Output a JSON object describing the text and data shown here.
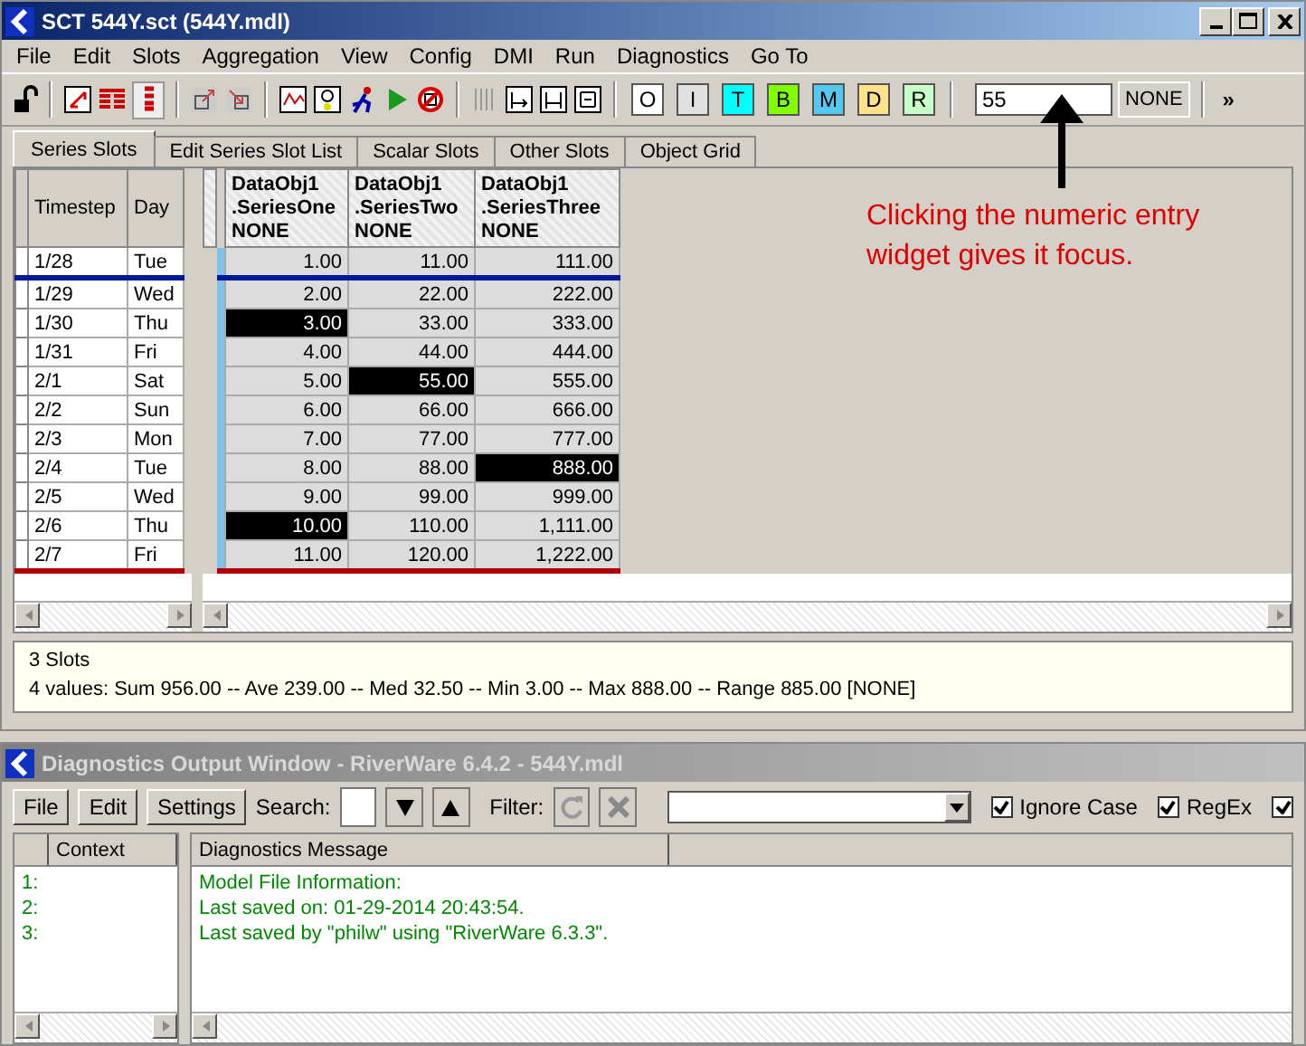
{
  "window": {
    "title": "SCT 544Y.sct (544Y.mdl)",
    "active": true
  },
  "menu": [
    "File",
    "Edit",
    "Slots",
    "Aggregation",
    "View",
    "Config",
    "DMI",
    "Run",
    "Diagnostics",
    "Go To"
  ],
  "flags": [
    {
      "label": "O",
      "color": "#ffffff"
    },
    {
      "label": "I",
      "color": "#e0e0e0"
    },
    {
      "label": "T",
      "color": "#00ffff"
    },
    {
      "label": "B",
      "color": "#80ff00"
    },
    {
      "label": "M",
      "color": "#55c8f0"
    },
    {
      "label": "D",
      "color": "#ffe28a"
    },
    {
      "label": "R",
      "color": "#c8ffc8"
    }
  ],
  "numeric_entry": {
    "value": "55",
    "units": "NONE"
  },
  "overflow": "»",
  "tabs": [
    {
      "label": "Series Slots",
      "selected": true
    },
    {
      "label": "Edit Series Slot List",
      "selected": false
    },
    {
      "label": "Scalar Slots",
      "selected": false
    },
    {
      "label": "Other Slots",
      "selected": false
    },
    {
      "label": "Object Grid",
      "selected": false
    }
  ],
  "annotation": "Clicking the numeric entry widget gives it focus.",
  "grid": {
    "columns": [
      "Timestep",
      "Day"
    ],
    "series": [
      {
        "object": "DataObj1",
        "slot": ".SeriesOne",
        "units": "NONE"
      },
      {
        "object": "DataObj1",
        "slot": ".SeriesTwo",
        "units": "NONE"
      },
      {
        "object": "DataObj1",
        "slot": ".SeriesThree",
        "units": "NONE"
      }
    ],
    "rows": [
      {
        "timestep": "1/28",
        "day": "Tue",
        "cells": [
          {
            "value": "1.00",
            "selected": false
          },
          {
            "value": "11.00",
            "selected": false
          },
          {
            "value": "111.00",
            "selected": false
          }
        ]
      },
      {
        "timestep": "1/29",
        "day": "Wed",
        "cells": [
          {
            "value": "2.00",
            "selected": false
          },
          {
            "value": "22.00",
            "selected": false
          },
          {
            "value": "222.00",
            "selected": false
          }
        ]
      },
      {
        "timestep": "1/30",
        "day": "Thu",
        "cells": [
          {
            "value": "3.00",
            "selected": true
          },
          {
            "value": "33.00",
            "selected": false
          },
          {
            "value": "333.00",
            "selected": false
          }
        ]
      },
      {
        "timestep": "1/31",
        "day": "Fri",
        "cells": [
          {
            "value": "4.00",
            "selected": false
          },
          {
            "value": "44.00",
            "selected": false
          },
          {
            "value": "444.00",
            "selected": false
          }
        ]
      },
      {
        "timestep": "2/1",
        "day": "Sat",
        "cells": [
          {
            "value": "5.00",
            "selected": false
          },
          {
            "value": "55.00",
            "selected": true
          },
          {
            "value": "555.00",
            "selected": false
          }
        ]
      },
      {
        "timestep": "2/2",
        "day": "Sun",
        "cells": [
          {
            "value": "6.00",
            "selected": false
          },
          {
            "value": "66.00",
            "selected": false
          },
          {
            "value": "666.00",
            "selected": false
          }
        ]
      },
      {
        "timestep": "2/3",
        "day": "Mon",
        "cells": [
          {
            "value": "7.00",
            "selected": false
          },
          {
            "value": "77.00",
            "selected": false
          },
          {
            "value": "777.00",
            "selected": false
          }
        ]
      },
      {
        "timestep": "2/4",
        "day": "Tue",
        "cells": [
          {
            "value": "8.00",
            "selected": false
          },
          {
            "value": "88.00",
            "selected": false
          },
          {
            "value": "888.00",
            "selected": true
          }
        ]
      },
      {
        "timestep": "2/5",
        "day": "Wed",
        "cells": [
          {
            "value": "9.00",
            "selected": false
          },
          {
            "value": "99.00",
            "selected": false
          },
          {
            "value": "999.00",
            "selected": false
          }
        ]
      },
      {
        "timestep": "2/6",
        "day": "Thu",
        "cells": [
          {
            "value": "10.00",
            "selected": true
          },
          {
            "value": "110.00",
            "selected": false
          },
          {
            "value": "1,111.00",
            "selected": false
          }
        ]
      },
      {
        "timestep": "2/7",
        "day": "Fri",
        "cells": [
          {
            "value": "11.00",
            "selected": false
          },
          {
            "value": "120.00",
            "selected": false
          },
          {
            "value": "1,222.00",
            "selected": false
          }
        ]
      }
    ]
  },
  "status": [
    "3 Slots",
    "4 values:  Sum 956.00 -- Ave 239.00 -- Med 32.50 -- Min 3.00 -- Max 888.00 -- Range 885.00 [NONE]"
  ],
  "diagnostics": {
    "title": "Diagnostics Output Window - RiverWare 6.4.2 - 544Y.mdl",
    "active": false,
    "buttons": [
      "File",
      "Edit",
      "Settings"
    ],
    "search_label": "Search:",
    "filter_label": "Filter:",
    "options": [
      {
        "label": "Ignore Case",
        "checked": true
      },
      {
        "label": "RegEx",
        "checked": true
      },
      {
        "checked": true
      }
    ],
    "columns": [
      "Context",
      "Diagnostics Message"
    ],
    "rows": [
      {
        "number": "1:",
        "message": "Model File Information:"
      },
      {
        "number": "2:",
        "message": "Last saved on: 01-29-2014 20:43:54."
      },
      {
        "number": "3:",
        "message": "Last saved by \"philw\" using \"RiverWare 6.3.3\"."
      }
    ]
  }
}
